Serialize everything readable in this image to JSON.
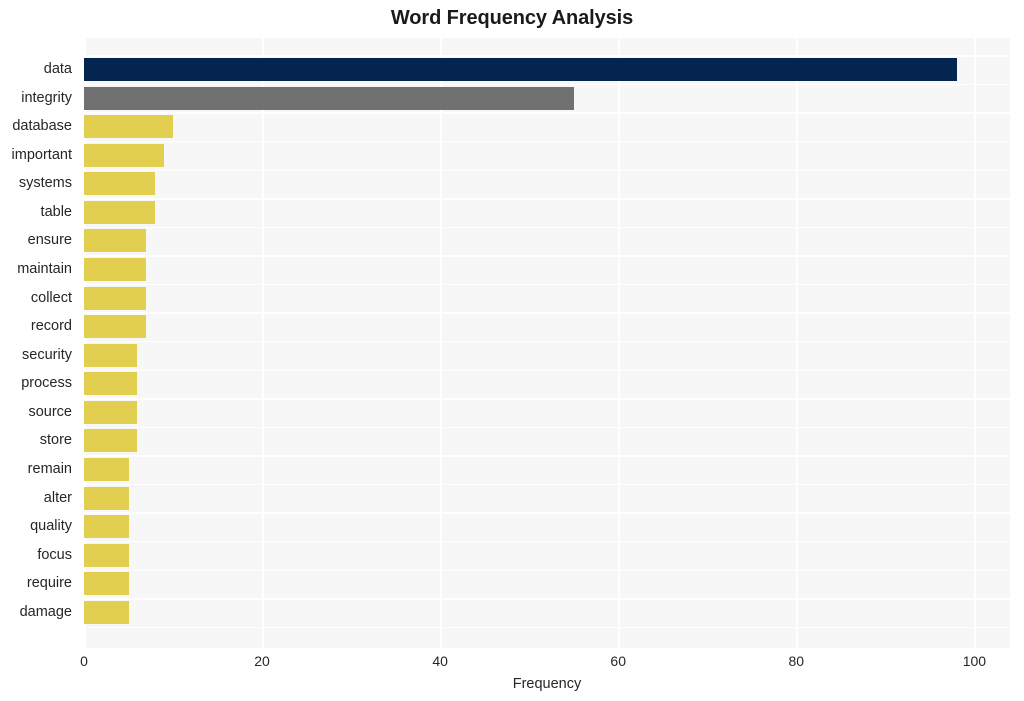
{
  "chart_data": {
    "type": "bar",
    "orientation": "horizontal",
    "title": "Word Frequency Analysis",
    "xlabel": "Frequency",
    "ylabel": "",
    "xlim": [
      0,
      104
    ],
    "xticks": [
      0,
      20,
      40,
      60,
      80,
      100
    ],
    "xtick_labels": [
      "0",
      "20",
      "40",
      "60",
      "80",
      "100"
    ],
    "grid": true,
    "legend": null,
    "categories": [
      "data",
      "integrity",
      "database",
      "important",
      "systems",
      "table",
      "ensure",
      "maintain",
      "collect",
      "record",
      "security",
      "process",
      "source",
      "store",
      "remain",
      "alter",
      "quality",
      "focus",
      "require",
      "damage"
    ],
    "values": [
      98,
      55,
      10,
      9,
      8,
      8,
      7,
      7,
      7,
      7,
      6,
      6,
      6,
      6,
      5,
      5,
      5,
      5,
      5,
      5
    ],
    "bar_colors": [
      "#04254f",
      "#717171",
      "#e3cf4f",
      "#e3cf4f",
      "#e3cf4f",
      "#e3cf4f",
      "#e3cf4f",
      "#e3cf4f",
      "#e3cf4f",
      "#e3cf4f",
      "#e3cf4f",
      "#e3cf4f",
      "#e3cf4f",
      "#e3cf4f",
      "#e3cf4f",
      "#e3cf4f",
      "#e3cf4f",
      "#e3cf4f",
      "#e3cf4f",
      "#e3cf4f"
    ]
  },
  "colors": {
    "plot_background": "#f7f7f7",
    "figure_background": "#ffffff",
    "gridline": "#ffffff",
    "text": "#262626",
    "title": "#1a1a1a",
    "accent_primary": "#04254f",
    "accent_secondary": "#717171",
    "accent_default": "#e3cf4f"
  }
}
